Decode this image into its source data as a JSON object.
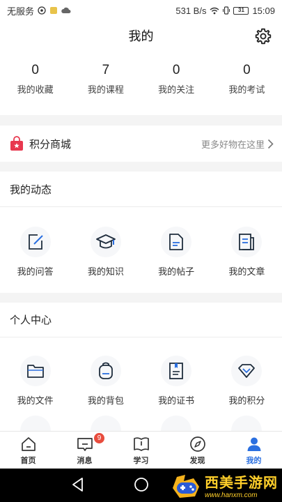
{
  "status_bar": {
    "carrier": "无服务",
    "speed": "531 B/s",
    "battery": "31",
    "time": "15:09"
  },
  "header": {
    "title": "我的"
  },
  "stats": [
    {
      "value": "0",
      "label": "我的收藏"
    },
    {
      "value": "7",
      "label": "我的课程"
    },
    {
      "value": "0",
      "label": "我的关注"
    },
    {
      "value": "0",
      "label": "我的考试"
    }
  ],
  "mall": {
    "title": "积分商城",
    "more": "更多好物在这里",
    "icon_color": "#e8384f"
  },
  "activity": {
    "title": "我的动态",
    "items": [
      {
        "label": "我的问答",
        "icon": "edit-icon"
      },
      {
        "label": "我的知识",
        "icon": "graduation-cap-icon"
      },
      {
        "label": "我的帖子",
        "icon": "document-icon"
      },
      {
        "label": "我的文章",
        "icon": "article-icon"
      }
    ]
  },
  "personal": {
    "title": "个人中心",
    "items": [
      {
        "label": "我的文件",
        "icon": "folder-icon"
      },
      {
        "label": "我的背包",
        "icon": "backpack-icon"
      },
      {
        "label": "我的证书",
        "icon": "certificate-icon"
      },
      {
        "label": "我的积分",
        "icon": "diamond-icon"
      }
    ]
  },
  "tabbar": {
    "items": [
      {
        "label": "首页",
        "icon": "home-icon"
      },
      {
        "label": "消息",
        "icon": "message-icon",
        "badge": "9"
      },
      {
        "label": "学习",
        "icon": "book-icon"
      },
      {
        "label": "发现",
        "icon": "compass-icon"
      },
      {
        "label": "我的",
        "icon": "user-icon",
        "active": true
      }
    ],
    "active_color": "#2a6fe0"
  },
  "watermark": {
    "title": "西美手游网",
    "url": "www.hanxm.com"
  }
}
